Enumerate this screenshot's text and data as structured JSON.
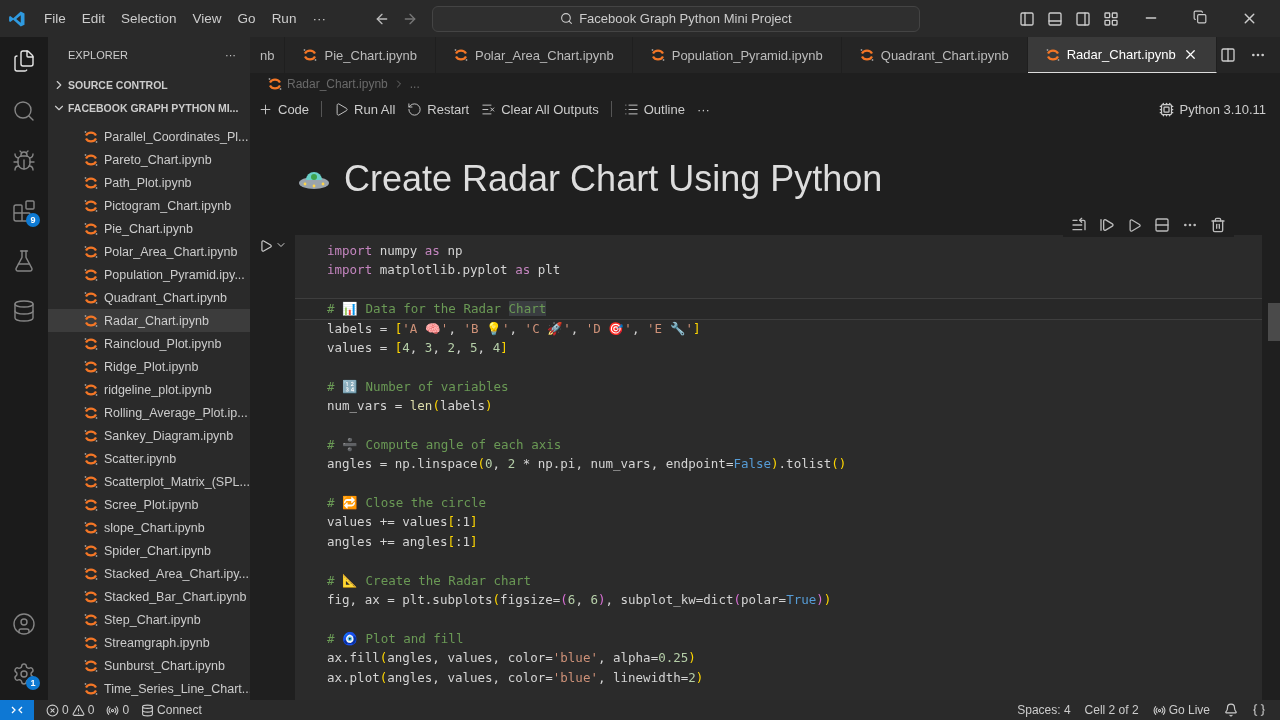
{
  "title_bar": {
    "menu": [
      "File",
      "Edit",
      "Selection",
      "View",
      "Go",
      "Run",
      "···"
    ],
    "search": "Facebook Graph Python Mini Project"
  },
  "activity_bar": {
    "top": [
      {
        "kind": "files",
        "selected": true
      },
      {
        "kind": "search",
        "selected": false
      },
      {
        "kind": "debug",
        "selected": false
      },
      {
        "kind": "extensions",
        "selected": false,
        "badge": "9"
      },
      {
        "kind": "testing",
        "selected": false
      },
      {
        "kind": "database",
        "selected": false
      }
    ],
    "bottom": [
      {
        "kind": "account"
      },
      {
        "kind": "settings",
        "badge": "1"
      }
    ]
  },
  "sidebar": {
    "title": "EXPLORER",
    "more": "···",
    "sections": [
      {
        "label": "SOURCE CONTROL",
        "expanded": false
      },
      {
        "label": "FACEBOOK GRAPH PYTHON MI...",
        "expanded": true
      }
    ],
    "files": [
      {
        "name": "Parallel_Coordinates_Pl...",
        "selected": false
      },
      {
        "name": "Pareto_Chart.ipynb",
        "selected": false
      },
      {
        "name": "Path_Plot.ipynb",
        "selected": false
      },
      {
        "name": "Pictogram_Chart.ipynb",
        "selected": false
      },
      {
        "name": "Pie_Chart.ipynb",
        "selected": false
      },
      {
        "name": "Polar_Area_Chart.ipynb",
        "selected": false
      },
      {
        "name": "Population_Pyramid.ipy...",
        "selected": false
      },
      {
        "name": "Quadrant_Chart.ipynb",
        "selected": false
      },
      {
        "name": "Radar_Chart.ipynb",
        "selected": true
      },
      {
        "name": "Raincloud_Plot.ipynb",
        "selected": false
      },
      {
        "name": "Ridge_Plot.ipynb",
        "selected": false
      },
      {
        "name": "ridgeline_plot.ipynb",
        "selected": false
      },
      {
        "name": "Rolling_Average_Plot.ip...",
        "selected": false
      },
      {
        "name": "Sankey_Diagram.ipynb",
        "selected": false
      },
      {
        "name": "Scatter.ipynb",
        "selected": false
      },
      {
        "name": "Scatterplot_Matrix_(SPL...",
        "selected": false
      },
      {
        "name": "Scree_Plot.ipynb",
        "selected": false
      },
      {
        "name": "slope_Chart.ipynb",
        "selected": false
      },
      {
        "name": "Spider_Chart.ipynb",
        "selected": false
      },
      {
        "name": "Stacked_Area_Chart.ipy...",
        "selected": false
      },
      {
        "name": "Stacked_Bar_Chart.ipynb",
        "selected": false
      },
      {
        "name": "Step_Chart.ipynb",
        "selected": false
      },
      {
        "name": "Streamgraph.ipynb",
        "selected": false
      },
      {
        "name": "Sunburst_Chart.ipynb",
        "selected": false
      },
      {
        "name": "Time_Series_Line_Chart...",
        "selected": false
      }
    ]
  },
  "tabs": [
    {
      "label": "nb",
      "selected": false,
      "cut": true
    },
    {
      "label": "Pie_Chart.ipynb",
      "selected": false,
      "cut": false
    },
    {
      "label": "Polar_Area_Chart.ipynb",
      "selected": false,
      "cut": false
    },
    {
      "label": "Population_Pyramid.ipynb",
      "selected": false,
      "cut": false
    },
    {
      "label": "Quadrant_Chart.ipynb",
      "selected": false,
      "cut": false
    },
    {
      "label": "Radar_Chart.ipynb",
      "selected": true,
      "cut": false
    }
  ],
  "breadcrumb": [
    "Radar_Chart.ipynb",
    "..."
  ],
  "notebook_toolbar": {
    "items": [
      {
        "kind": "add",
        "label": "Code"
      },
      {
        "kind": "run",
        "label": "Run All"
      },
      {
        "kind": "restart",
        "label": "Restart"
      },
      {
        "kind": "clear",
        "label": "Clear All Outputs"
      },
      {
        "kind": "outline",
        "label": "Outline"
      },
      {
        "kind": "more",
        "label": "···"
      }
    ],
    "kernel": "Python 3.10.11"
  },
  "notebook": {
    "heading": "Create Radar Chart Using Python",
    "cell": {
      "lines": [
        {
          "kind": "code",
          "current": false,
          "tokens": [
            {
              "t": "import",
              "kind": "kw"
            },
            {
              "t": " numpy ",
              "kind": "plain"
            },
            {
              "t": "as",
              "kind": "kw"
            },
            {
              "t": " np",
              "kind": "plain"
            }
          ]
        },
        {
          "kind": "code",
          "current": false,
          "tokens": [
            {
              "t": "import",
              "kind": "kw"
            },
            {
              "t": " matplotlib.pyplot ",
              "kind": "plain"
            },
            {
              "t": "as",
              "kind": "kw"
            },
            {
              "t": " plt",
              "kind": "plain"
            }
          ]
        },
        {
          "kind": "blank"
        },
        {
          "kind": "code",
          "current": true,
          "tokens": [
            {
              "t": "# 📊 Data for the Radar ",
              "kind": "comment"
            },
            {
              "t": "Chart",
              "kind": "match"
            }
          ]
        },
        {
          "kind": "code",
          "current": false,
          "tokens": [
            {
              "t": "labels = ",
              "kind": "plain"
            },
            {
              "t": "[",
              "kind": "b1"
            },
            {
              "t": "'A 🧠'",
              "kind": "str"
            },
            {
              "t": ", ",
              "kind": "plain"
            },
            {
              "t": "'B 💡'",
              "kind": "str"
            },
            {
              "t": ", ",
              "kind": "plain"
            },
            {
              "t": "'C 🚀'",
              "kind": "str"
            },
            {
              "t": ", ",
              "kind": "plain"
            },
            {
              "t": "'D 🎯'",
              "kind": "str"
            },
            {
              "t": ", ",
              "kind": "plain"
            },
            {
              "t": "'E 🔧'",
              "kind": "str"
            },
            {
              "t": "]",
              "kind": "b1"
            }
          ]
        },
        {
          "kind": "code",
          "current": false,
          "tokens": [
            {
              "t": "values = ",
              "kind": "plain"
            },
            {
              "t": "[",
              "kind": "b1"
            },
            {
              "t": "4",
              "kind": "num"
            },
            {
              "t": ", ",
              "kind": "plain"
            },
            {
              "t": "3",
              "kind": "num"
            },
            {
              "t": ", ",
              "kind": "plain"
            },
            {
              "t": "2",
              "kind": "num"
            },
            {
              "t": ", ",
              "kind": "plain"
            },
            {
              "t": "5",
              "kind": "num"
            },
            {
              "t": ", ",
              "kind": "plain"
            },
            {
              "t": "4",
              "kind": "num"
            },
            {
              "t": "]",
              "kind": "b1"
            }
          ]
        },
        {
          "kind": "blank"
        },
        {
          "kind": "code",
          "current": false,
          "tokens": [
            {
              "t": "# 🔢 Number of variables",
              "kind": "comment"
            }
          ]
        },
        {
          "kind": "code",
          "current": false,
          "tokens": [
            {
              "t": "num_vars = ",
              "kind": "plain"
            },
            {
              "t": "len",
              "kind": "fn"
            },
            {
              "t": "(",
              "kind": "b1"
            },
            {
              "t": "labels",
              "kind": "plain"
            },
            {
              "t": ")",
              "kind": "b1"
            }
          ]
        },
        {
          "kind": "blank"
        },
        {
          "kind": "code",
          "current": false,
          "tokens": [
            {
              "t": "# ➗ Compute angle of each axis",
              "kind": "comment"
            }
          ]
        },
        {
          "kind": "code",
          "current": false,
          "tokens": [
            {
              "t": "angles = np.linspace",
              "kind": "plain"
            },
            {
              "t": "(",
              "kind": "b1"
            },
            {
              "t": "0",
              "kind": "num"
            },
            {
              "t": ", ",
              "kind": "plain"
            },
            {
              "t": "2",
              "kind": "num"
            },
            {
              "t": " * np.pi, num_vars, endpoint=",
              "kind": "plain"
            },
            {
              "t": "False",
              "kind": "const"
            },
            {
              "t": ")",
              "kind": "b1"
            },
            {
              "t": ".tolist",
              "kind": "plain"
            },
            {
              "t": "()",
              "kind": "b1"
            }
          ]
        },
        {
          "kind": "blank"
        },
        {
          "kind": "code",
          "current": false,
          "tokens": [
            {
              "t": "# 🔁 Close the circle",
              "kind": "comment"
            }
          ]
        },
        {
          "kind": "code",
          "current": false,
          "tokens": [
            {
              "t": "values += values",
              "kind": "plain"
            },
            {
              "t": "[",
              "kind": "b1"
            },
            {
              "t": ":1",
              "kind": "plain"
            },
            {
              "t": "]",
              "kind": "b1"
            }
          ]
        },
        {
          "kind": "code",
          "current": false,
          "tokens": [
            {
              "t": "angles += angles",
              "kind": "plain"
            },
            {
              "t": "[",
              "kind": "b1"
            },
            {
              "t": ":1",
              "kind": "plain"
            },
            {
              "t": "]",
              "kind": "b1"
            }
          ]
        },
        {
          "kind": "blank"
        },
        {
          "kind": "code",
          "current": false,
          "tokens": [
            {
              "t": "# 📐 Create the Radar chart",
              "kind": "comment"
            }
          ]
        },
        {
          "kind": "code",
          "current": false,
          "tokens": [
            {
              "t": "fig, ax = plt.subplots",
              "kind": "plain"
            },
            {
              "t": "(",
              "kind": "b1"
            },
            {
              "t": "figsize=",
              "kind": "plain"
            },
            {
              "t": "(",
              "kind": "b2"
            },
            {
              "t": "6",
              "kind": "num"
            },
            {
              "t": ", ",
              "kind": "plain"
            },
            {
              "t": "6",
              "kind": "num"
            },
            {
              "t": ")",
              "kind": "b2"
            },
            {
              "t": ", subplot_kw=dict",
              "kind": "plain"
            },
            {
              "t": "(",
              "kind": "b2"
            },
            {
              "t": "polar=",
              "kind": "plain"
            },
            {
              "t": "True",
              "kind": "const"
            },
            {
              "t": ")",
              "kind": "b2"
            },
            {
              "t": ")",
              "kind": "b1"
            }
          ]
        },
        {
          "kind": "blank"
        },
        {
          "kind": "code",
          "current": false,
          "tokens": [
            {
              "t": "# 🧿 Plot and fill",
              "kind": "comment"
            }
          ]
        },
        {
          "kind": "code",
          "current": false,
          "tokens": [
            {
              "t": "ax.fill",
              "kind": "plain"
            },
            {
              "t": "(",
              "kind": "b1"
            },
            {
              "t": "angles, values, color=",
              "kind": "plain"
            },
            {
              "t": "'blue'",
              "kind": "str"
            },
            {
              "t": ", alpha=",
              "kind": "plain"
            },
            {
              "t": "0.25",
              "kind": "num"
            },
            {
              "t": ")",
              "kind": "b1"
            }
          ]
        },
        {
          "kind": "code",
          "current": false,
          "tokens": [
            {
              "t": "ax.plot",
              "kind": "plain"
            },
            {
              "t": "(",
              "kind": "b1"
            },
            {
              "t": "angles, values, color=",
              "kind": "plain"
            },
            {
              "t": "'blue'",
              "kind": "str"
            },
            {
              "t": ", linewidth=",
              "kind": "plain"
            },
            {
              "t": "2",
              "kind": "num"
            },
            {
              "t": ")",
              "kind": "b1"
            }
          ]
        }
      ]
    }
  },
  "status_bar": {
    "errors": "0",
    "warnings": "0",
    "ports": "0",
    "connect": "Connect",
    "right": [
      {
        "kind": "text",
        "label": "Spaces: 4"
      },
      {
        "kind": "text",
        "label": "Cell 2 of 2"
      },
      {
        "kind": "live",
        "label": "Go Live"
      }
    ]
  }
}
